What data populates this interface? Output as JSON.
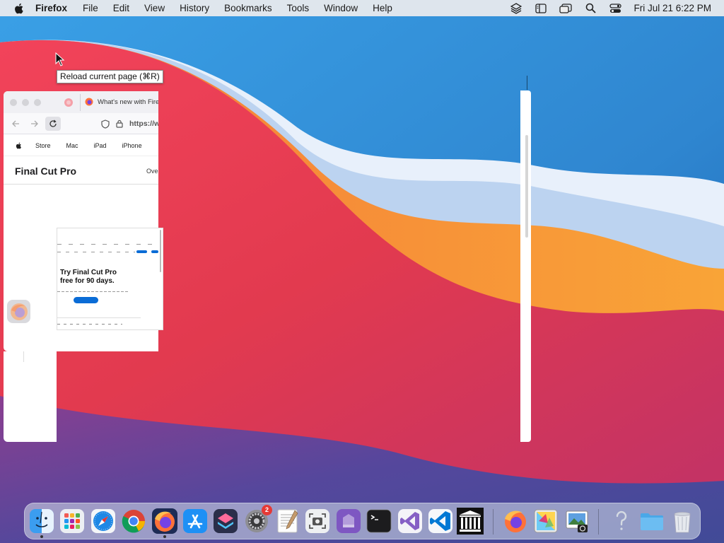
{
  "menubar": {
    "app_name": "Firefox",
    "items": [
      "File",
      "Edit",
      "View",
      "History",
      "Bookmarks",
      "Tools",
      "Window",
      "Help"
    ],
    "clock": "Fri Jul 21  6:22 PM"
  },
  "tooltip": {
    "text": "Reload current page (⌘R)"
  },
  "firefox_window": {
    "tab_title": "What's new with Firefo",
    "url_text": "https://w",
    "apple_nav": [
      "Store",
      "Mac",
      "iPad",
      "iPhone"
    ],
    "product_title": "Final Cut Pro",
    "product_link": "Over"
  },
  "thumbnail": {
    "headline_line1": "Try Final Cut Pro",
    "headline_line2": "free for 90 days."
  },
  "dock": {
    "items": [
      {
        "name": "Finder",
        "icon": "finder-icon"
      },
      {
        "name": "Launchpad",
        "icon": "launchpad-icon"
      },
      {
        "name": "Safari",
        "icon": "safari-icon"
      },
      {
        "name": "Google Chrome",
        "icon": "chrome-icon"
      },
      {
        "name": "Firefox",
        "icon": "firefox-icon"
      },
      {
        "name": "App Store",
        "icon": "app-store-icon"
      },
      {
        "name": "Shortcuts",
        "icon": "shortcuts-icon"
      },
      {
        "name": "System Preferences",
        "icon": "system-preferences-icon",
        "badge": "2"
      },
      {
        "name": "TextEdit",
        "icon": "textedit-icon"
      },
      {
        "name": "Screenshot",
        "icon": "screenshot-icon"
      },
      {
        "name": "Vanilla",
        "icon": "vanilla-icon"
      },
      {
        "name": "Terminal",
        "icon": "terminal-icon"
      },
      {
        "name": "Visual Studio",
        "icon": "visual-studio-icon"
      },
      {
        "name": "Visual Studio Code",
        "icon": "vscode-icon"
      },
      {
        "name": "Museum",
        "icon": "museum-icon"
      },
      {
        "name": "Firefox",
        "icon": "firefox-icon"
      },
      {
        "name": "ColorSync Utility",
        "icon": "colorsync-icon"
      },
      {
        "name": "Preview",
        "icon": "preview-icon"
      },
      {
        "name": "Help",
        "icon": "question-icon"
      },
      {
        "name": "Folder",
        "icon": "folder-icon"
      },
      {
        "name": "Trash",
        "icon": "trash-icon"
      }
    ]
  },
  "colors": {
    "accent_blue": "#0a6cd6",
    "badge_red": "#e53935"
  }
}
